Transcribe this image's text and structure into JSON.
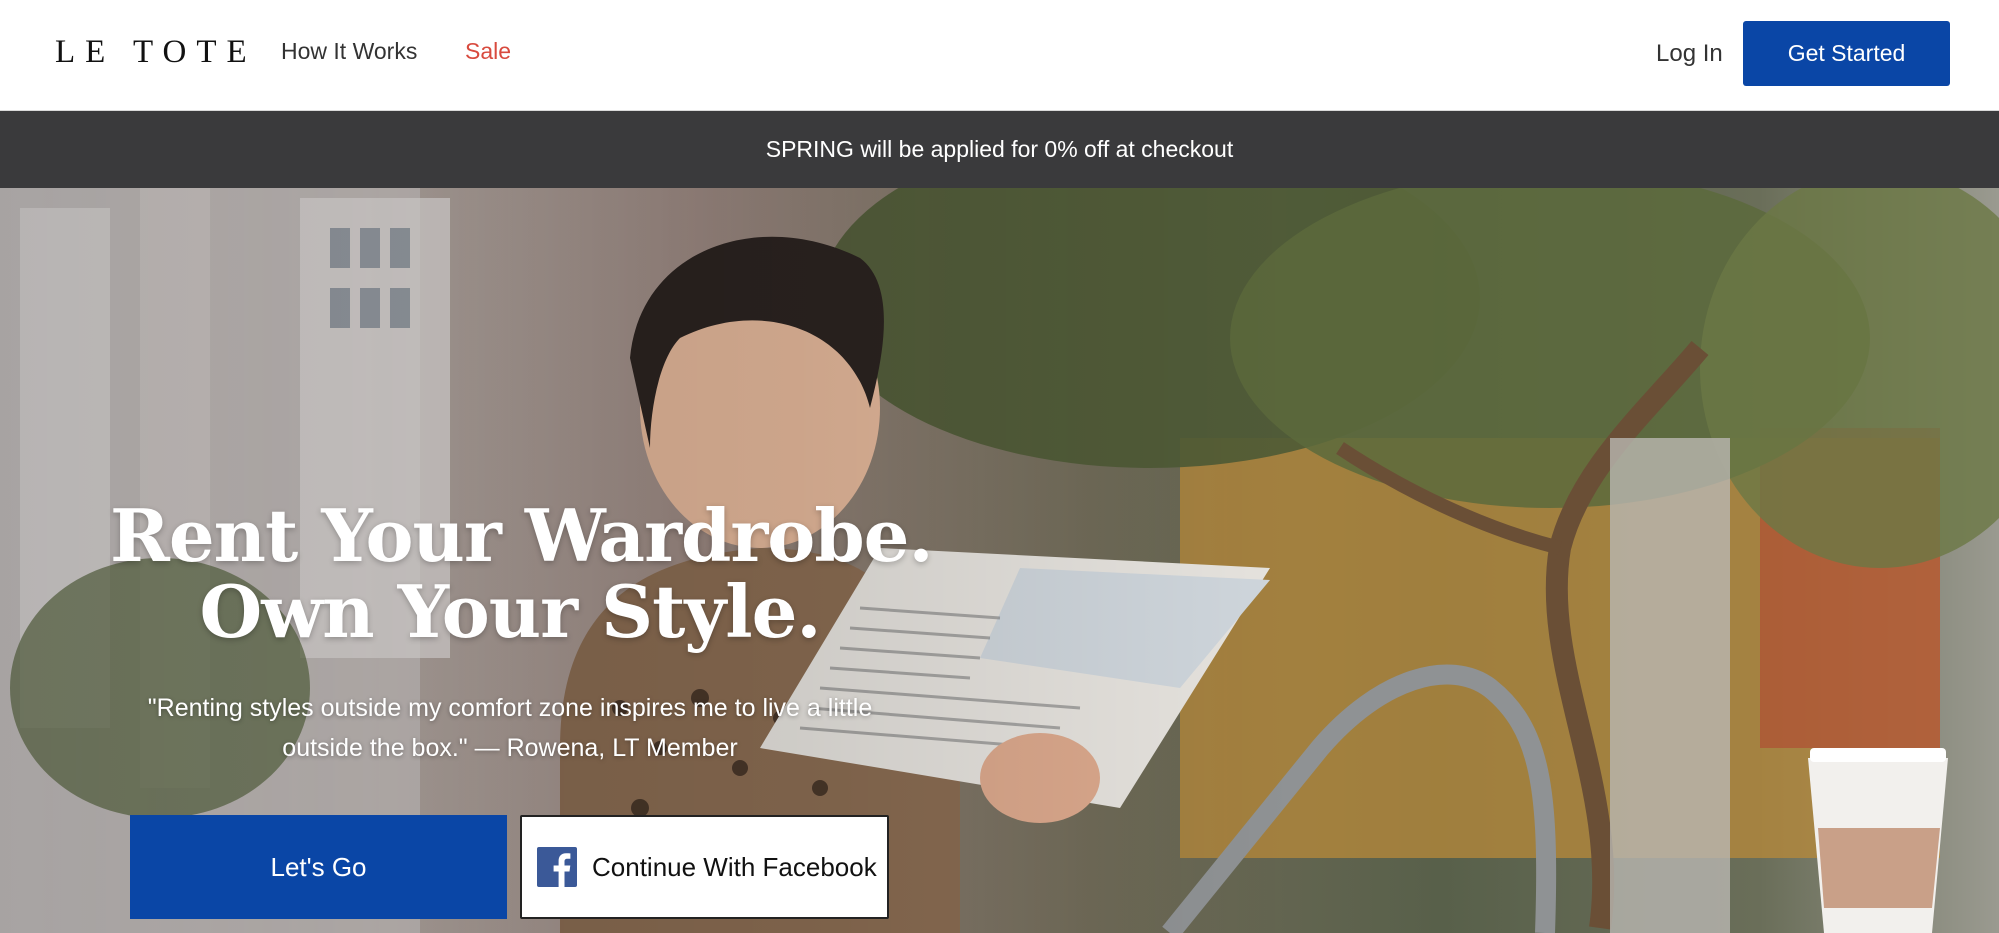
{
  "header": {
    "logo": "LE TOTE",
    "nav": [
      {
        "label": "How It Works"
      },
      {
        "label": "Sale"
      }
    ],
    "login_label": "Log In",
    "cta_label": "Get Started"
  },
  "promo_bar": {
    "text": "SPRING will be applied for 0% off at checkout"
  },
  "hero": {
    "headline_line1": "Rent Your Wardrobe.",
    "headline_line2": "Own Your Style.",
    "quote": "\"Renting styles outside my comfort zone inspires me to live a little outside the box.\" — Rowena, LT Member",
    "primary_button": "Let's Go",
    "facebook_button": "Continue With Facebook"
  },
  "icons": {
    "facebook": "facebook-icon"
  },
  "colors": {
    "brand_blue": "#0a46a6",
    "sale_red": "#d84a3e",
    "promo_bg": "#3a3a3c",
    "facebook_blue": "#3b5998"
  }
}
